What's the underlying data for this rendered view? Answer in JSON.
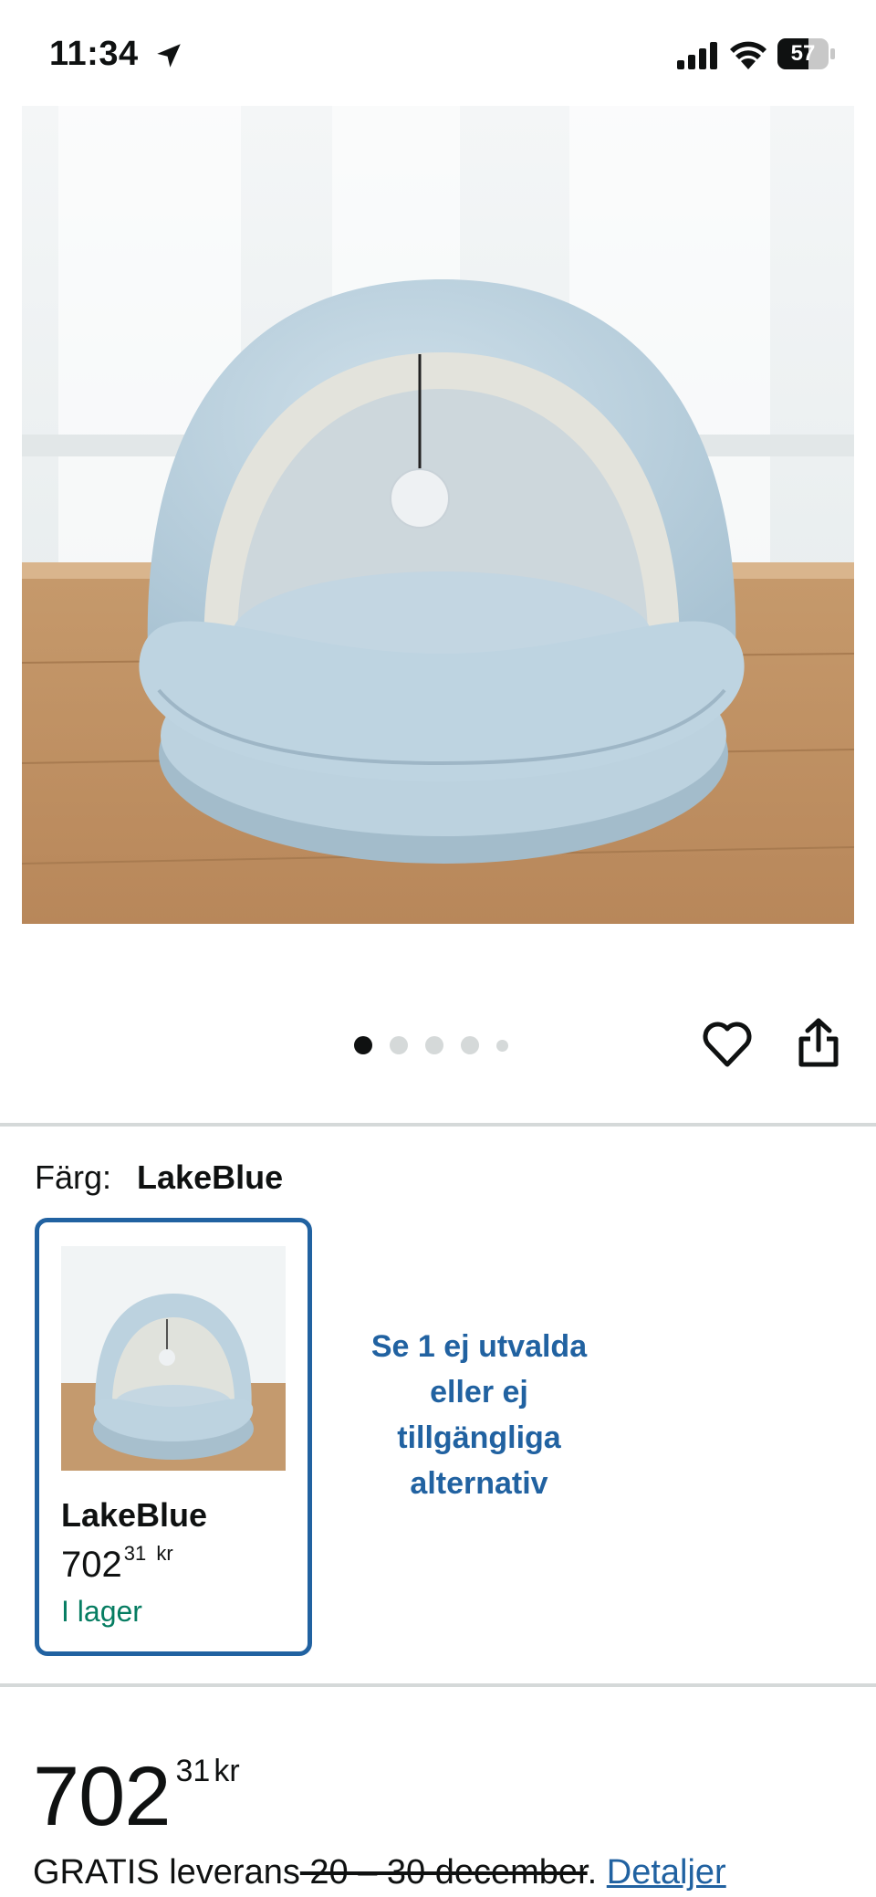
{
  "status_bar": {
    "time": "11:34",
    "battery": "57",
    "icons": [
      "location-arrow-icon",
      "signal-icon",
      "wifi-icon",
      "battery-icon"
    ]
  },
  "product": {
    "image_alt_icon": "cat-bed-photo",
    "carousel": {
      "total": 5,
      "active": 1
    },
    "actions": [
      "heart-icon",
      "share-icon"
    ]
  },
  "color_selection": {
    "label": "Färg:",
    "value": "LakeBlue",
    "variants": [
      {
        "name": "LakeBlue",
        "price_whole": "702",
        "price_cents": "31",
        "currency": "kr",
        "stock": "I lager"
      }
    ],
    "other_options_text": "Se 1 ej utvalda eller ej tillgängliga alternativ"
  },
  "price": {
    "whole": "702",
    "cents": "31",
    "currency": "kr"
  },
  "delivery": {
    "prefix": "GRATIS leverans",
    "struck": " 20 – 30 december",
    "suffix": ". ",
    "details_link": "Detaljer"
  },
  "colors": {
    "accent_blue": "#2162a1",
    "in_stock_green": "#067d62",
    "divider": "#d5d9d9"
  }
}
